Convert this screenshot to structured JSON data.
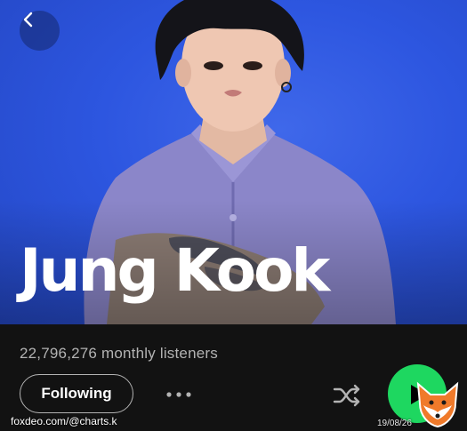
{
  "header": {
    "back_icon": "chevron-left-icon"
  },
  "hero": {
    "artist_name": "Jung Kook",
    "background_color": "#2d56e0"
  },
  "artist": {
    "monthly_listeners": "22,796,276 monthly listeners"
  },
  "actions": {
    "follow_label": "Following",
    "more_icon": "more-horizontal-icon",
    "shuffle_icon": "shuffle-icon",
    "play_icon": "play-icon",
    "accent_color": "#1ed760"
  },
  "watermark": {
    "source": "foxdeo.com/@charts.k",
    "date": "19/08/26",
    "logo_icon": "fox-logo-icon"
  }
}
